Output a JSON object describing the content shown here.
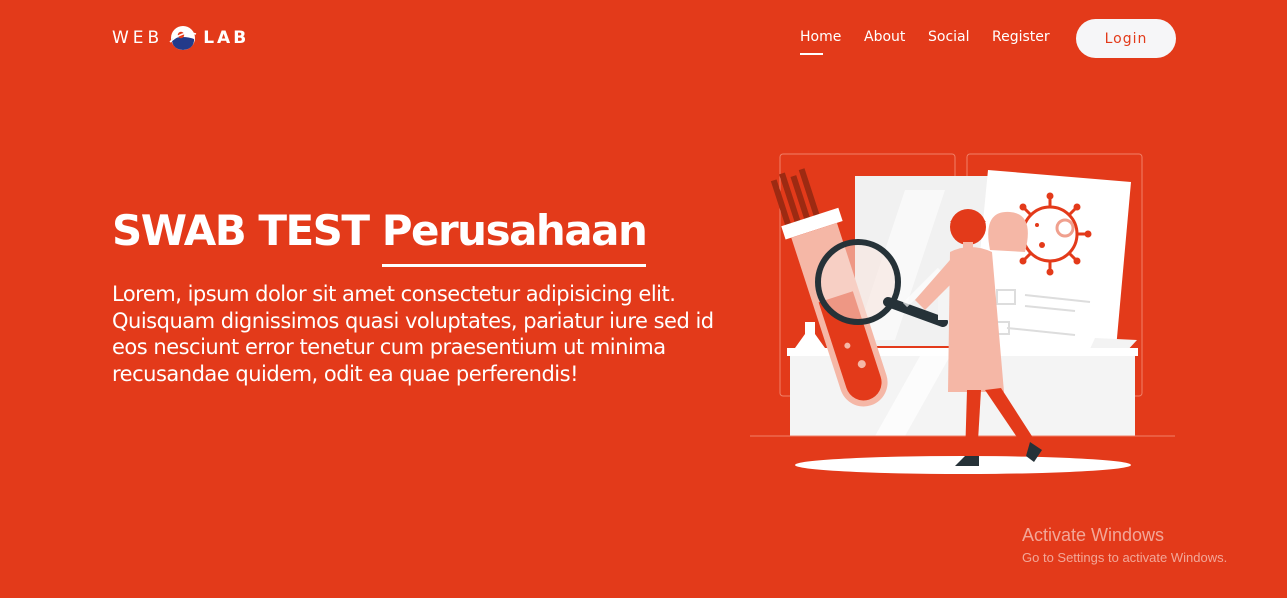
{
  "brand": {
    "left": "WEB",
    "right": "LAB"
  },
  "nav": {
    "items": [
      {
        "label": "Home",
        "active": true
      },
      {
        "label": "About",
        "active": false
      },
      {
        "label": "Social",
        "active": false
      },
      {
        "label": "Register",
        "active": false
      }
    ],
    "login_label": "Login"
  },
  "hero": {
    "title_plain": "SWAB TEST",
    "title_highlight": "Perusahaan",
    "body": "Lorem, ipsum dolor sit amet consectetur adipisicing elit. Quisquam dignissimos quasi voluptates, pariatur iure sed id eos nesciunt error tenetur cum praesentium ut minima recusandae quidem, odit ea quae perferendis!"
  },
  "watermark": {
    "title": "Activate Windows",
    "subtitle": "Go to Settings to activate Windows."
  },
  "colors": {
    "background": "#e33a1a",
    "button_bg": "#f6f6f8",
    "text": "#ffffff"
  },
  "illustration_icon": "lab-scientist-illustration"
}
